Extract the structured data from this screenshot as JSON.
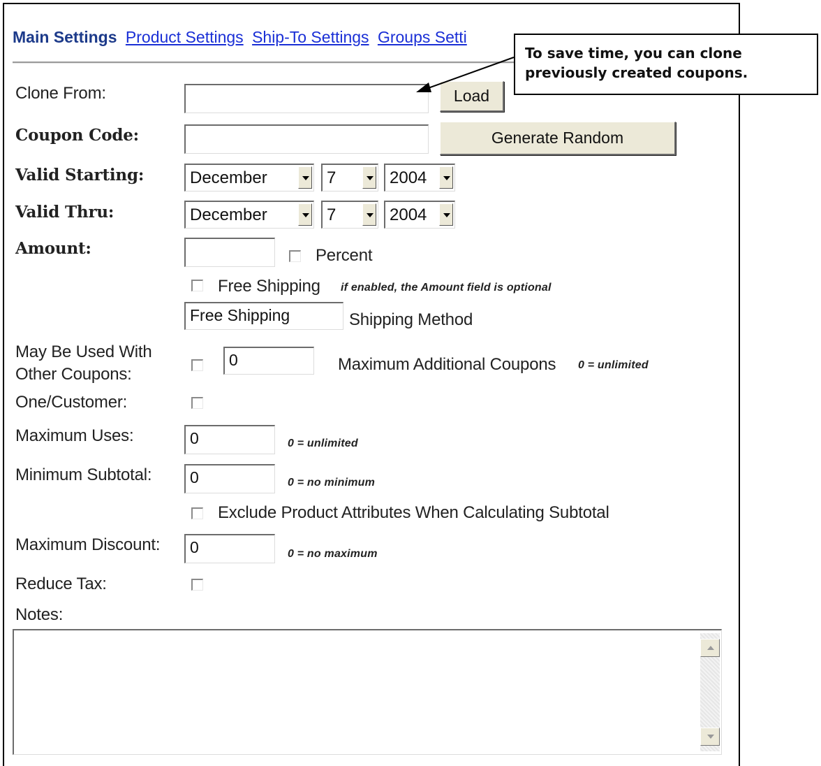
{
  "tabs": {
    "active": "Main Settings",
    "product": "Product Settings",
    "ship_to": "Ship-To Settings",
    "groups": "Groups Setti"
  },
  "callout": {
    "line1": "To save time, you can clone",
    "line2": "previously created coupons."
  },
  "clone": {
    "label": "Clone From:",
    "value": "",
    "button": "Load"
  },
  "coupon_code": {
    "label": "Coupon Code:",
    "value": "",
    "button": "Generate Random"
  },
  "valid_starting": {
    "label": "Valid Starting:",
    "month": "December",
    "day": "7",
    "year": "2004"
  },
  "valid_thru": {
    "label": "Valid Thru:",
    "month": "December",
    "day": "7",
    "year": "2004"
  },
  "amount": {
    "label": "Amount:",
    "value": "",
    "percent_label": "Percent",
    "percent_checked": false
  },
  "free_shipping": {
    "label": "Free Shipping",
    "hint": "if enabled, the Amount field is optional",
    "checked": false
  },
  "shipping_method": {
    "value": "Free Shipping",
    "label": "Shipping Method"
  },
  "other_coupons": {
    "label_line1": "May Be Used With",
    "label_line2": "Other Coupons:",
    "checked": false,
    "max_value": "0",
    "max_label": "Maximum Additional Coupons",
    "max_hint": "0 = unlimited"
  },
  "one_per_customer": {
    "label": "One/Customer:",
    "checked": false
  },
  "maximum_uses": {
    "label": "Maximum Uses:",
    "value": "0",
    "hint": "0 = unlimited"
  },
  "minimum_subtotal": {
    "label": "Minimum Subtotal:",
    "value": "0",
    "hint": "0 = no minimum"
  },
  "exclude_attributes": {
    "label": "Exclude Product Attributes When Calculating Subtotal",
    "checked": false
  },
  "maximum_discount": {
    "label": "Maximum Discount:",
    "value": "0",
    "hint": "0 = no maximum"
  },
  "reduce_tax": {
    "label": "Reduce Tax:",
    "checked": false
  },
  "notes": {
    "label": "Notes:",
    "value": ""
  },
  "colors": {
    "tab_active": "#1c3a8a",
    "tab_link": "#1a2fd6",
    "button_face": "#ece9d8"
  }
}
